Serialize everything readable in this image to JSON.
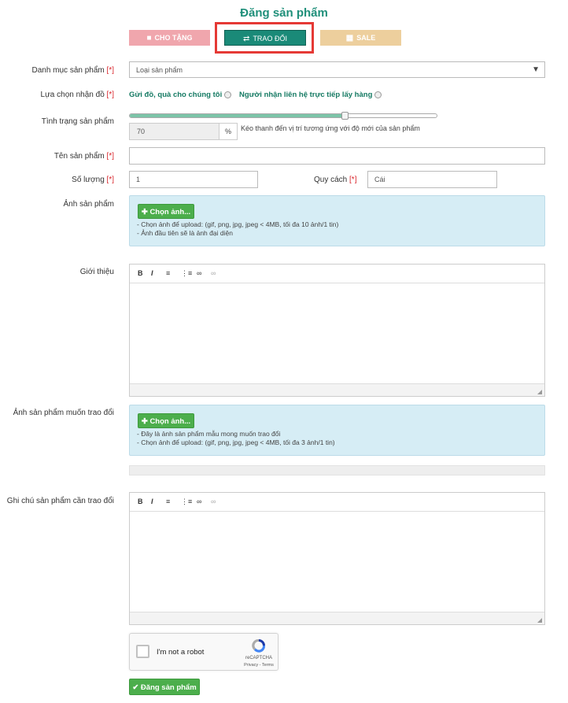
{
  "page": {
    "title": "Đăng sản phẩm"
  },
  "modes": [
    {
      "label": "CHO TẶNG",
      "icon": "gift-icon",
      "color": "#f0a6ad"
    },
    {
      "label": "TRAO ĐỔI",
      "icon": "exchange-icon",
      "color": "#1a8a78",
      "selected": true,
      "highlight": "#e53935"
    },
    {
      "label": "SALE",
      "icon": "basket-icon",
      "color": "#edcf9d"
    }
  ],
  "form": {
    "required_mark": "[*]",
    "category": {
      "label": "Danh mục sản phẩm",
      "value": "Loại sản phẩm"
    },
    "receive": {
      "label": "Lựa chọn nhận đồ",
      "option1": "Gửi đồ, quà cho chúng tôi",
      "option2": "Người nhận liên hệ trực tiếp lấy hàng"
    },
    "condition": {
      "label": "Tình trạng sản phẩm",
      "value": "70",
      "unit": "%",
      "hint": "Kéo thanh đến vị trí tương ứng với độ mới của sản phẩm",
      "level_percent": 70
    },
    "name": {
      "label": "Tên sản phẩm",
      "value": ""
    },
    "quantity": {
      "label": "Số lượng",
      "value": "1"
    },
    "spec": {
      "label": "Quy cách",
      "value": "Cái"
    },
    "images": {
      "label": "Ảnh sản phẩm",
      "button": "Chọn ảnh...",
      "hint1": "- Chọn ảnh để upload: (gif, png, jpg, jpeg < 4MB, tối đa 10 ảnh/1 tin)",
      "hint2": "- Ảnh đầu tiên sẽ là ảnh đại diện"
    },
    "intro": {
      "label": "Giới thiệu"
    },
    "exchange_images": {
      "label": "Ảnh sản phẩm muốn trao đổi",
      "button": "Chọn ảnh...",
      "hint1": "- Đây là ảnh sản phẩm mẫu mong muốn trao đổi",
      "hint2": "- Chọn ảnh để upload: (gif, png, jpg, jpeg < 4MB, tối đa 3 ảnh/1 tin)"
    },
    "exchange_note": {
      "label": "Ghi chú sản phẩm cần trao đổi"
    },
    "toolbar": {
      "bold": "B",
      "italic": "I"
    }
  },
  "captcha": {
    "label": "I'm not a robot",
    "brand": "reCAPTCHA",
    "links": "Privacy - Terms"
  },
  "submit": {
    "label": "Đăng sản phẩm"
  }
}
